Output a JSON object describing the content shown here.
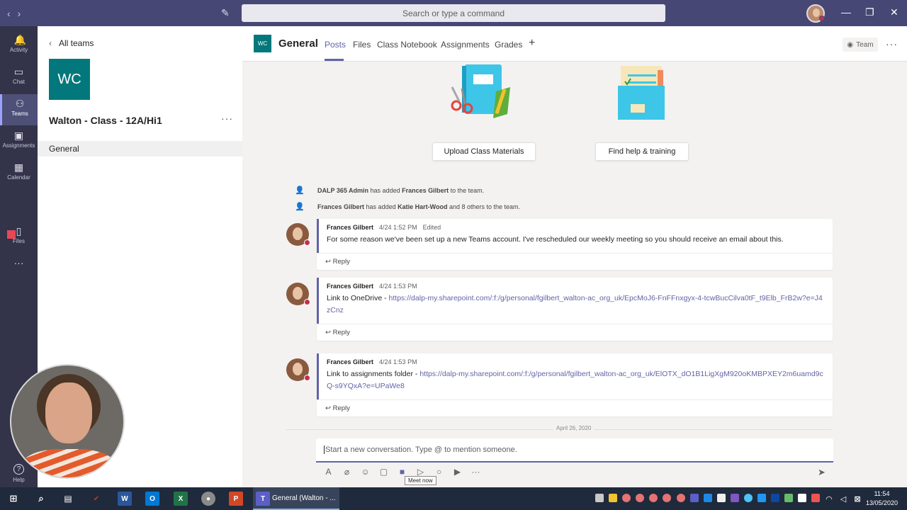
{
  "titlebar": {
    "search_placeholder": "Search or type a command",
    "back": "‹",
    "forward": "›",
    "minimize": "—",
    "maximize": "❐",
    "close": "✕"
  },
  "rail": {
    "items": [
      {
        "label": "Activity",
        "icon": "bell-icon",
        "glyph": "🔔"
      },
      {
        "label": "Chat",
        "icon": "chat-icon",
        "glyph": "▭"
      },
      {
        "label": "Teams",
        "icon": "teams-icon",
        "glyph": "⚇"
      },
      {
        "label": "Assignments",
        "icon": "assignments-icon",
        "glyph": "▣"
      },
      {
        "label": "Calendar",
        "icon": "calendar-icon",
        "glyph": "▦"
      },
      {
        "label": "Files",
        "icon": "files-icon",
        "glyph": "▯"
      }
    ],
    "more": "···",
    "help": "Help",
    "help_glyph": "?"
  },
  "teampane": {
    "back_label": "All teams",
    "tile": "WC",
    "team_name": "Walton - Class - 12A/Hi1",
    "more": "···",
    "channel": "General"
  },
  "header": {
    "tile": "WC",
    "title": "General",
    "tabs": [
      "Posts",
      "Files",
      "Class Notebook",
      "Assignments",
      "Grades"
    ],
    "add_tab": "+",
    "team_button": "Team",
    "more": "···"
  },
  "posts": {
    "upload_button": "Upload Class Materials",
    "help_button": "Find help & training",
    "system_events": [
      {
        "actor": "DALP 365 Admin",
        "verb": "has added",
        "target": "Frances Gilbert",
        "tail": "to the team."
      },
      {
        "actor": "Frances Gilbert",
        "verb": "has added",
        "target": "Katie Hart-Wood",
        "tail": "and 8 others to the team."
      }
    ],
    "messages": [
      {
        "author": "Frances Gilbert",
        "time": "4/24 1:52 PM",
        "edited": "Edited",
        "text": "For some reason we've been set up a new Teams account.  I've rescheduled our weekly meeting so you should receive an email about this.",
        "link": "",
        "reply": "Reply"
      },
      {
        "author": "Frances Gilbert",
        "time": "4/24 1:53 PM",
        "edited": "",
        "text": "Link to OneDrive - ",
        "link": "https://dalp-my.sharepoint.com/:f:/g/personal/fgilbert_walton-ac_org_uk/EpcMoJ6-FnFFnxgyx-4-tcwBucCilva0tF_t9Elb_FrB2w?e=J4zCnz",
        "reply": "Reply"
      },
      {
        "author": "Frances Gilbert",
        "time": "4/24 1:53 PM",
        "edited": "",
        "text": "Link to assignments folder - ",
        "link": "https://dalp-my.sharepoint.com/:f:/g/personal/fgilbert_walton-ac_org_uk/ElOTX_dO1B1LigXgM920oKMBPXEY2m6uamd9cQ-s9YQxA?e=UPaWe8",
        "reply": "Reply"
      }
    ],
    "date_separator": "April 26, 2020",
    "compose_placeholder": "Start a new conversation. Type @ to mention someone.",
    "tooltip": "Meet now"
  },
  "taskbar": {
    "active_window": "General (Walton - ...",
    "time": "11:54",
    "date": "13/05/2020"
  },
  "colors": {
    "brand": "#6264a7",
    "titlebar": "#464775",
    "rail": "#33344a",
    "team_tile": "#03787c",
    "presence_busy": "#c4314b"
  }
}
